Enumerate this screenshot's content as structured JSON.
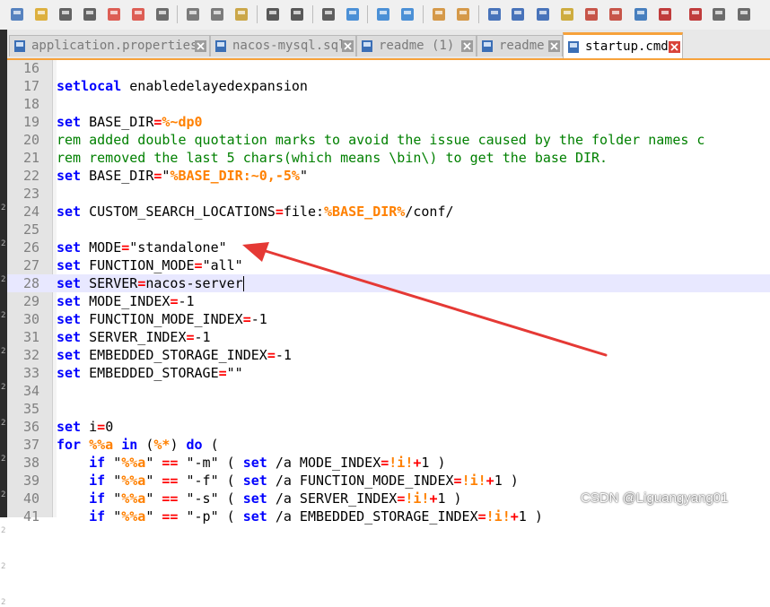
{
  "colors": {
    "keyword": "#0000ff",
    "operator": "#ff0000",
    "variable": "#ff8000",
    "comment": "#008000",
    "active_tab_accent": "#f7a23b",
    "arrow": "#e53935"
  },
  "toolbar": {
    "icons": [
      "new-file-icon",
      "open-file-icon",
      "save-icon",
      "save-all-icon",
      "close-icon",
      "close-all-icon",
      "print-icon",
      "cut-icon",
      "copy-icon",
      "paste-icon",
      "undo-icon",
      "redo-icon",
      "find-icon",
      "replace-icon",
      "zoom-in-icon",
      "zoom-out-icon",
      "sync-vertical-icon",
      "sync-horizontal-icon",
      "word-wrap-icon",
      "show-all-chars-icon",
      "indent-guide-icon",
      "document-map-icon",
      "function-list-icon",
      "folder-workspace-icon",
      "monitor-icon",
      "record-macro-icon",
      "stop-record-icon",
      "play-macro-icon",
      "run-macro-icon",
      "save-macro-icon"
    ]
  },
  "tabs": [
    {
      "label": "application.properties",
      "active": false
    },
    {
      "label": "nacos-mysql.sql",
      "active": false
    },
    {
      "label": "readme (1)",
      "active": false
    },
    {
      "label": "readme",
      "active": false
    },
    {
      "label": "startup.cmd",
      "active": true
    }
  ],
  "editor": {
    "current_line": "28",
    "lines": [
      {
        "n": "16",
        "t": []
      },
      {
        "n": "17",
        "t": [
          [
            "kw",
            "setlocal"
          ],
          [
            "p",
            " enabledelayedexpansion"
          ]
        ]
      },
      {
        "n": "18",
        "t": []
      },
      {
        "n": "19",
        "t": [
          [
            "kw",
            "set"
          ],
          [
            "p",
            " BASE_DIR"
          ],
          [
            "op",
            "="
          ],
          [
            "var",
            "%~dp0"
          ]
        ]
      },
      {
        "n": "20",
        "t": [
          [
            "cm",
            "rem added double quotation marks to avoid the issue caused by the folder names c"
          ]
        ]
      },
      {
        "n": "21",
        "t": [
          [
            "cm",
            "rem removed the last 5 chars(which means \\bin\\) to get the base DIR."
          ]
        ]
      },
      {
        "n": "22",
        "t": [
          [
            "kw",
            "set"
          ],
          [
            "p",
            " BASE_DIR"
          ],
          [
            "op",
            "="
          ],
          [
            "p",
            "\""
          ],
          [
            "var",
            "%BASE_DIR:~0,-5%"
          ],
          [
            "p",
            "\""
          ]
        ]
      },
      {
        "n": "23",
        "t": []
      },
      {
        "n": "24",
        "t": [
          [
            "kw",
            "set"
          ],
          [
            "p",
            " CUSTOM_SEARCH_LOCATIONS"
          ],
          [
            "op",
            "="
          ],
          [
            "p",
            "file:"
          ],
          [
            "var",
            "%BASE_DIR%"
          ],
          [
            "p",
            "/conf/"
          ]
        ]
      },
      {
        "n": "25",
        "t": []
      },
      {
        "n": "26",
        "t": [
          [
            "kw",
            "set"
          ],
          [
            "p",
            " MODE"
          ],
          [
            "op",
            "="
          ],
          [
            "p",
            "\"standalone\""
          ]
        ]
      },
      {
        "n": "27",
        "t": [
          [
            "kw",
            "set"
          ],
          [
            "p",
            " FUNCTION_MODE"
          ],
          [
            "op",
            "="
          ],
          [
            "p",
            "\"all\""
          ]
        ]
      },
      {
        "n": "28",
        "t": [
          [
            "kw",
            "set"
          ],
          [
            "p",
            " SERVER"
          ],
          [
            "op",
            "="
          ],
          [
            "p",
            "nacos-server"
          ]
        ]
      },
      {
        "n": "29",
        "t": [
          [
            "kw",
            "set"
          ],
          [
            "p",
            " MODE_INDEX"
          ],
          [
            "op",
            "="
          ],
          [
            "p",
            "-1"
          ]
        ]
      },
      {
        "n": "30",
        "t": [
          [
            "kw",
            "set"
          ],
          [
            "p",
            " FUNCTION_MODE_INDEX"
          ],
          [
            "op",
            "="
          ],
          [
            "p",
            "-1"
          ]
        ]
      },
      {
        "n": "31",
        "t": [
          [
            "kw",
            "set"
          ],
          [
            "p",
            " SERVER_INDEX"
          ],
          [
            "op",
            "="
          ],
          [
            "p",
            "-1"
          ]
        ]
      },
      {
        "n": "32",
        "t": [
          [
            "kw",
            "set"
          ],
          [
            "p",
            " EMBEDDED_STORAGE_INDEX"
          ],
          [
            "op",
            "="
          ],
          [
            "p",
            "-1"
          ]
        ]
      },
      {
        "n": "33",
        "t": [
          [
            "kw",
            "set"
          ],
          [
            "p",
            " EMBEDDED_STORAGE"
          ],
          [
            "op",
            "="
          ],
          [
            "p",
            "\"\""
          ]
        ]
      },
      {
        "n": "34",
        "t": []
      },
      {
        "n": "35",
        "t": []
      },
      {
        "n": "36",
        "t": [
          [
            "kw",
            "set"
          ],
          [
            "p",
            " i"
          ],
          [
            "op",
            "="
          ],
          [
            "p",
            "0"
          ]
        ]
      },
      {
        "n": "37",
        "t": [
          [
            "kw",
            "for"
          ],
          [
            "p",
            " "
          ],
          [
            "var",
            "%%a"
          ],
          [
            "p",
            " "
          ],
          [
            "kw",
            "in"
          ],
          [
            "p",
            " ("
          ],
          [
            "var",
            "%*"
          ],
          [
            "p",
            ") "
          ],
          [
            "kw",
            "do"
          ],
          [
            "p",
            " ("
          ]
        ]
      },
      {
        "n": "38",
        "t": [
          [
            "p",
            "    "
          ],
          [
            "kw",
            "if"
          ],
          [
            "p",
            " \""
          ],
          [
            "var",
            "%%a"
          ],
          [
            "p",
            "\" "
          ],
          [
            "op",
            "=="
          ],
          [
            "p",
            " \"-m\" ( "
          ],
          [
            "kw",
            "set"
          ],
          [
            "p",
            " /a MODE_INDEX"
          ],
          [
            "op",
            "="
          ],
          [
            "var",
            "!i!"
          ],
          [
            "op",
            "+"
          ],
          [
            "p",
            "1 )"
          ]
        ]
      },
      {
        "n": "39",
        "t": [
          [
            "p",
            "    "
          ],
          [
            "kw",
            "if"
          ],
          [
            "p",
            " \""
          ],
          [
            "var",
            "%%a"
          ],
          [
            "p",
            "\" "
          ],
          [
            "op",
            "=="
          ],
          [
            "p",
            " \"-f\" ( "
          ],
          [
            "kw",
            "set"
          ],
          [
            "p",
            " /a FUNCTION_MODE_INDEX"
          ],
          [
            "op",
            "="
          ],
          [
            "var",
            "!i!"
          ],
          [
            "op",
            "+"
          ],
          [
            "p",
            "1 )"
          ]
        ]
      },
      {
        "n": "40",
        "t": [
          [
            "p",
            "    "
          ],
          [
            "kw",
            "if"
          ],
          [
            "p",
            " \""
          ],
          [
            "var",
            "%%a"
          ],
          [
            "p",
            "\" "
          ],
          [
            "op",
            "=="
          ],
          [
            "p",
            " \"-s\" ( "
          ],
          [
            "kw",
            "set"
          ],
          [
            "p",
            " /a SERVER_INDEX"
          ],
          [
            "op",
            "="
          ],
          [
            "var",
            "!i!"
          ],
          [
            "op",
            "+"
          ],
          [
            "p",
            "1 )"
          ]
        ]
      },
      {
        "n": "41",
        "t": [
          [
            "p",
            "    "
          ],
          [
            "kw",
            "if"
          ],
          [
            "p",
            " \""
          ],
          [
            "var",
            "%%a"
          ],
          [
            "p",
            "\" "
          ],
          [
            "op",
            "=="
          ],
          [
            "p",
            " \"-p\" ( "
          ],
          [
            "kw",
            "set"
          ],
          [
            "p",
            " /a EMBEDDED_STORAGE_INDEX"
          ],
          [
            "op",
            "="
          ],
          [
            "var",
            "!i!"
          ],
          [
            "op",
            "+"
          ],
          [
            "p",
            "1 )"
          ]
        ]
      }
    ]
  },
  "left_strip_marks": [
    "2",
    "2",
    "2",
    "2",
    "2",
    "2",
    "2",
    "2",
    "2",
    "2",
    "2",
    "2"
  ],
  "watermark": "CSDN @Liguangyang01"
}
